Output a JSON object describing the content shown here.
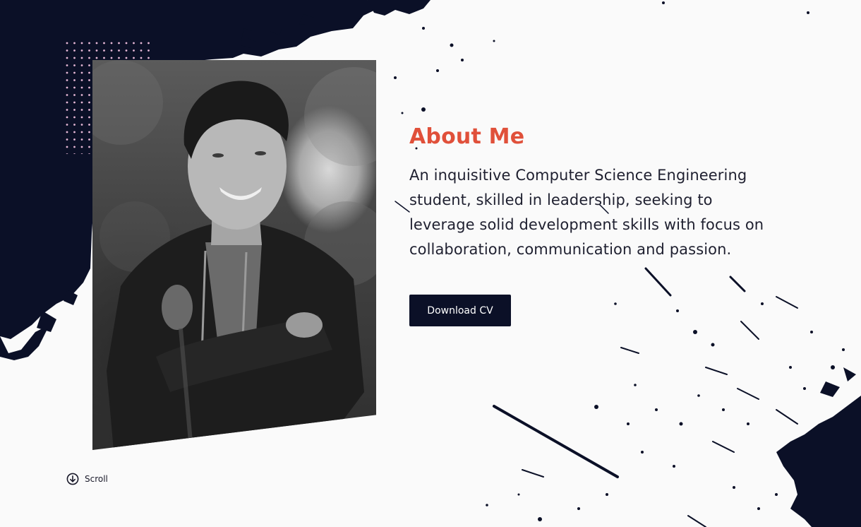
{
  "about": {
    "heading": "About Me",
    "description": "An inquisitive Computer Science Engineering student, skilled in leadership, seeking to leverage solid development skills with focus on collaboration, communication and passion."
  },
  "actions": {
    "download_label": "Download CV"
  },
  "scroll": {
    "label": "Scroll"
  },
  "colors": {
    "navy": "#0b1027",
    "accent": "#e0503a",
    "background": "#fafafa"
  },
  "icons": {
    "scroll": "arrow-down-circle-icon"
  }
}
